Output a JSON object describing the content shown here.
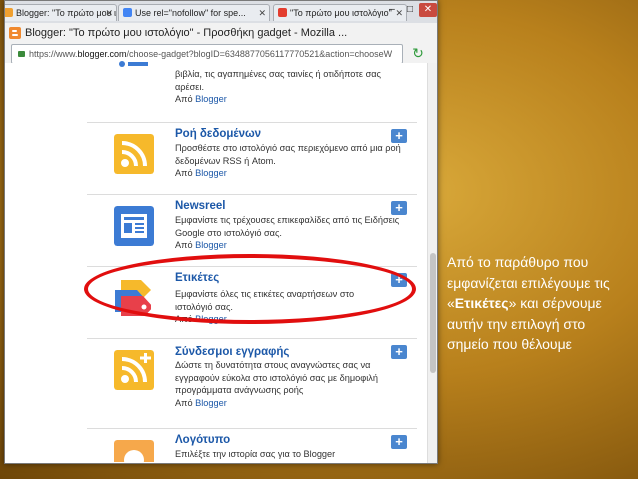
{
  "browser": {
    "tabs": [
      {
        "label": "Blogger: \"Το πρώτο μου ι...",
        "active": false,
        "favicon_color": "#f0a030"
      },
      {
        "label": "Use rel=\"nofollow\" for spe...",
        "active": false,
        "favicon_color": "#4285f4"
      },
      {
        "label": "\"Το πρώτο μου ιστολόγιο\"",
        "active": false,
        "favicon_color": "#e33d2f"
      }
    ],
    "window_title": "Blogger: \"Το πρώτο μου ιστολόγιο\" - Προσθήκη gadget - Mozilla ...",
    "url_prefix": "https://www.",
    "url_host": "blogger.com",
    "url_rest": "/choose-gadget?blogID=6348877056117770521&action=chooseW",
    "controls": {
      "minimize": "–",
      "maximize": "□",
      "close": "✕"
    }
  },
  "gadgets": [
    {
      "title": "",
      "desc": "βιβλία, τις αγαπημένες σας ταινίες ή οτιδήποτε σας αρέσει.",
      "by_prefix": "Από",
      "by": "Blogger",
      "icon": "list-icon",
      "color": "#3c7bd4"
    },
    {
      "title": "Ροή δεδομένων",
      "desc": "Προσθέστε στο ιστολόγιό σας περιεχόμενο από μια ροή δεδομένων RSS ή Atom.",
      "by_prefix": "Από",
      "by": "Blogger",
      "icon": "rss-icon",
      "color": "#f6b92b"
    },
    {
      "title": "Newsreel",
      "desc": "Εμφανίστε τις τρέχουσες επικεφαλίδες από τις Ειδήσεις Google στο ιστολόγιό σας.",
      "by_prefix": "Από",
      "by": "Blogger",
      "icon": "newsreel-icon",
      "color": "#3c7bd4"
    },
    {
      "title": "Ετικέτες",
      "desc": "Εμφανίστε όλες τις ετικέτες αναρτήσεων στο ιστολόγιό σας.",
      "by_prefix": "Από",
      "by": "Blogger",
      "icon": "labels-icon",
      "color": "#e8404a"
    },
    {
      "title": "Σύνδεσμοι εγγραφής",
      "desc": "Δώστε τη δυνατότητα στους αναγνώστες σας να εγγραφούν εύκολα στο ιστολόγιό σας με δημοφιλή προγράμματα ανάγνωσης ροής",
      "by_prefix": "Από",
      "by": "Blogger",
      "icon": "subscribe-rss-icon",
      "color": "#f6b92b"
    },
    {
      "title": "Λογότυπο",
      "desc": "Επιλέξτε την ιστορία σας για το Blogger",
      "by_prefix": "",
      "by": "",
      "icon": "logo-icon",
      "color": "#f6a84b"
    }
  ],
  "add_button_label": "+",
  "caption": {
    "line1": "Από το παράθυρο που εμφανίζεται επιλέγουμε τις",
    "quote_open": "«",
    "bold": "Ετικέτες",
    "quote_close": "»",
    "line2": " και σέρνουμε αυτήν την επιλογή στο σημείο που θέλουμε"
  }
}
